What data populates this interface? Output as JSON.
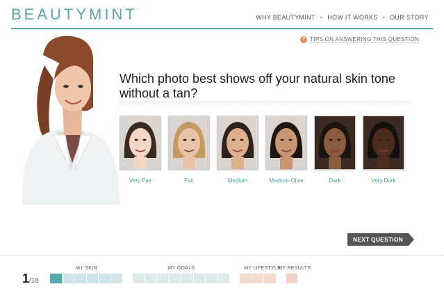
{
  "header": {
    "logo_text": "BEAUTYMINT",
    "nav": [
      "WHY BEAUTYMINT",
      "HOW IT WORKS",
      "OUR STORY"
    ],
    "tips_label": "TIPS ON ANSWERING THIS QUESTION"
  },
  "question": {
    "text": "Which photo best shows off your natural skin tone without a tan?",
    "options": [
      {
        "label": "Very Fair",
        "skin": "#f3d7c4"
      },
      {
        "label": "Fair",
        "skin": "#e9c3a5"
      },
      {
        "label": "Medium",
        "skin": "#ddb08b"
      },
      {
        "label": "Medium-Olive",
        "skin": "#c79670"
      },
      {
        "label": "Dark",
        "skin": "#8a5b3c"
      },
      {
        "label": "Very Dark",
        "skin": "#4c2c1d"
      }
    ]
  },
  "next_button": "NEXT QUESTION",
  "progress": {
    "current": "1",
    "total": "/18",
    "sections": [
      {
        "label": "MY SKIN",
        "segments": 6,
        "filled": 1,
        "color": "#cfe4e6",
        "fill_color": "#5aa6ad"
      },
      {
        "label": "MY GOALS",
        "segments": 8,
        "filled": 0,
        "color": "#dcebe9",
        "fill_color": "#5aa6ad"
      },
      {
        "label": "MY LIFESTYLE",
        "segments": 3,
        "filled": 0,
        "color": "#f5d9cd",
        "fill_color": "#e8876a"
      },
      {
        "label": "MY RESULTS",
        "segments": 1,
        "filled": 0,
        "color": "#f3d2c5",
        "fill_color": "#e8876a"
      }
    ]
  },
  "colors": {
    "brand": "#5aa6ad",
    "accent": "#e8876a"
  }
}
